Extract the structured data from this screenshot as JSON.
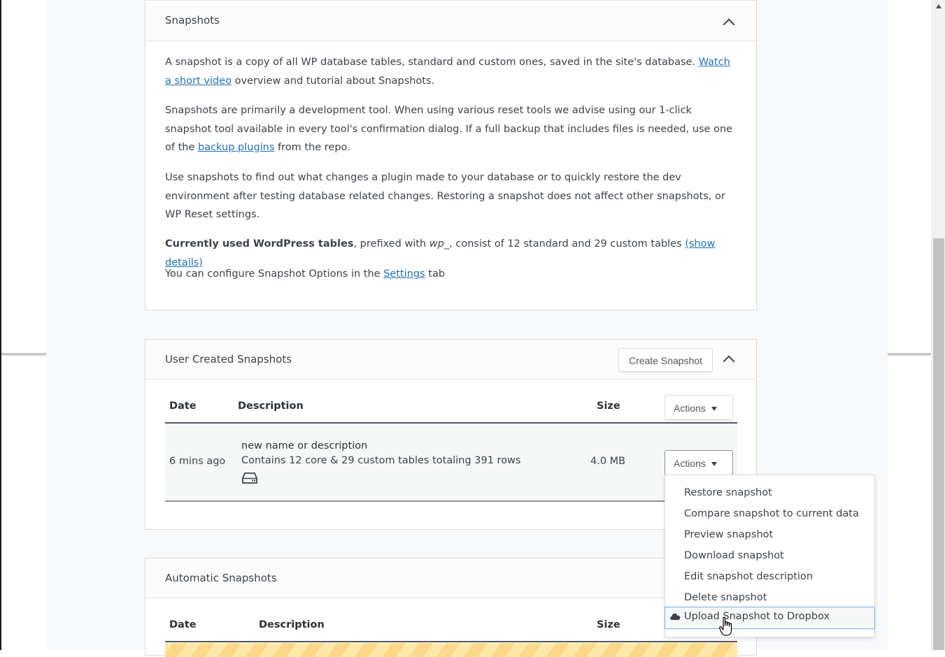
{
  "snapshots_card": {
    "title": "Snapshots",
    "p1_text": "A snapshot is a copy of all WP database tables, standard and custom ones, saved in the site's database. ",
    "p1_link": "Watch a short video",
    "p1_tail": " overview and tutorial about Snapshots.",
    "p2_text": "Snapshots are primarily a development tool. When using various reset tools we advise using our 1-click snapshot tool available in every tool's confirmation dialog. If a full backup that includes files is needed, use one of the ",
    "p2_link": "backup plugins",
    "p2_tail": " from the repo.",
    "p3_text": "Use snapshots to find out what changes a plugin made to your database or to quickly restore the dev environment after testing database related changes. Restoring a snapshot does not affect other snapshots, or WP Reset settings.",
    "p4_strong": "Currently used WordPress tables",
    "p4_mid": ", prefixed with ",
    "p4_prefix": "wp_",
    "p4_tail": ", consist of 12 standard and 29 custom tables ",
    "p4_link": "(show details)",
    "p5_text": "You can configure Snapshot Options in the ",
    "p5_link": "Settings",
    "p5_tail": " tab"
  },
  "user_snapshots": {
    "title": "User Created Snapshots",
    "create_button": "Create Snapshot",
    "columns": {
      "date": "Date",
      "description": "Description",
      "size": "Size",
      "actions": "Actions"
    },
    "rows": [
      {
        "date": "6 mins ago",
        "name": "new name or description",
        "details": "Contains 12 core & 29 custom tables totaling 391 rows",
        "storage_icon": "hard-drive-icon",
        "size": "4.0 MB",
        "actions": "Actions"
      }
    ]
  },
  "automatic_snapshots": {
    "title": "Automatic Snapshots",
    "columns": {
      "date": "Date",
      "description": "Description",
      "size": "Size"
    }
  },
  "actions_menu": {
    "items": [
      "Restore snapshot",
      "Compare snapshot to current data",
      "Preview snapshot",
      "Download snapshot",
      "Edit snapshot description",
      "Delete snapshot",
      "Upload Snapshot to Dropbox"
    ],
    "active_index": 6,
    "active_icon": "cloud-icon"
  }
}
